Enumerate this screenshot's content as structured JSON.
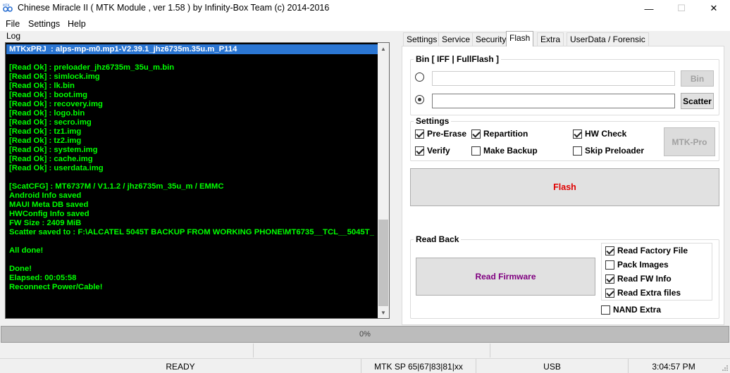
{
  "window": {
    "title": "Chinese Miracle II ( MTK Module , ver 1.58 ) by Infinity-Box Team (c) 2014-2016",
    "icon_label": "MTK",
    "minimize_glyph": "—",
    "maximize_glyph": "☐",
    "close_glyph": "✕"
  },
  "menu": [
    "File",
    "Settings",
    "Help"
  ],
  "log": {
    "label": "Log",
    "highlighted_line": "MTKxPRJ  : alps-mp-m0.mp1-V2.39.1_jhz6735m.35u.m_P114",
    "lines": [
      "",
      "[Read Ok] : preloader_jhz6735m_35u_m.bin",
      "[Read Ok] : simlock.img",
      "[Read Ok] : lk.bin",
      "[Read Ok] : boot.img",
      "[Read Ok] : recovery.img",
      "[Read Ok] : logo.bin",
      "[Read Ok] : secro.img",
      "[Read Ok] : tz1.img",
      "[Read Ok] : tz2.img",
      "[Read Ok] : system.img",
      "[Read Ok] : cache.img",
      "[Read Ok] : userdata.img",
      "",
      "[ScatCFG] : MT6737M / V1.1.2 / jhz6735m_35u_m / EMMC",
      "Android Info saved",
      "MAUI Meta DB saved",
      "HWConfig Info saved",
      "FW Size : 2409 MiB",
      "Scatter saved to : F:\\ALCATEL 5045T BACKUP FROM WORKING PHONE\\MT6735__TCL__5045T_",
      "",
      "All done!",
      "",
      "Done!",
      "Elapsed: 00:05:58",
      "Reconnect Power/Cable!"
    ],
    "text_color": "#00ff00",
    "highlight_color": "#2b76d3"
  },
  "tabs": [
    "Settings",
    "Service",
    "Security",
    "Flash",
    "Extra",
    "UserData / Forensic"
  ],
  "active_tab": "Flash",
  "flash": {
    "bin_group": {
      "title": "Bin  [ IFF | FullFlash ]",
      "bin_button": "Bin",
      "scatter_button": "Scatter",
      "bin_path": "",
      "scatter_path": "",
      "selected": "scatter"
    },
    "settings_group": {
      "title": "Settings",
      "options": [
        {
          "label": "Pre-Erase",
          "checked": true
        },
        {
          "label": "Repartition",
          "checked": true
        },
        {
          "label": "HW Check",
          "checked": true
        },
        {
          "label": "Verify",
          "checked": true
        },
        {
          "label": "Make Backup",
          "checked": false
        },
        {
          "label": "Skip Preloader",
          "checked": false
        }
      ],
      "mtk_pro_button": "MTK-Pro"
    },
    "flash_button": "Flash",
    "flash_button_color": "#e00000",
    "read_back": {
      "title": "Read Back",
      "read_firmware_button": "Read Firmware",
      "read_firmware_color": "#800080",
      "options": [
        {
          "label": "Read Factory File",
          "checked": true
        },
        {
          "label": "Pack Images",
          "checked": false
        },
        {
          "label": "Read FW Info",
          "checked": true
        },
        {
          "label": "Read Extra files",
          "checked": true
        }
      ],
      "nand_extra": {
        "label": "NAND Extra",
        "checked": false
      }
    }
  },
  "progress": {
    "label": "0%",
    "value": 0
  },
  "status": {
    "state": "READY",
    "platform": "MTK SP 65|67|83|81|xx",
    "interface": "USB",
    "time": "3:04:57 PM"
  }
}
